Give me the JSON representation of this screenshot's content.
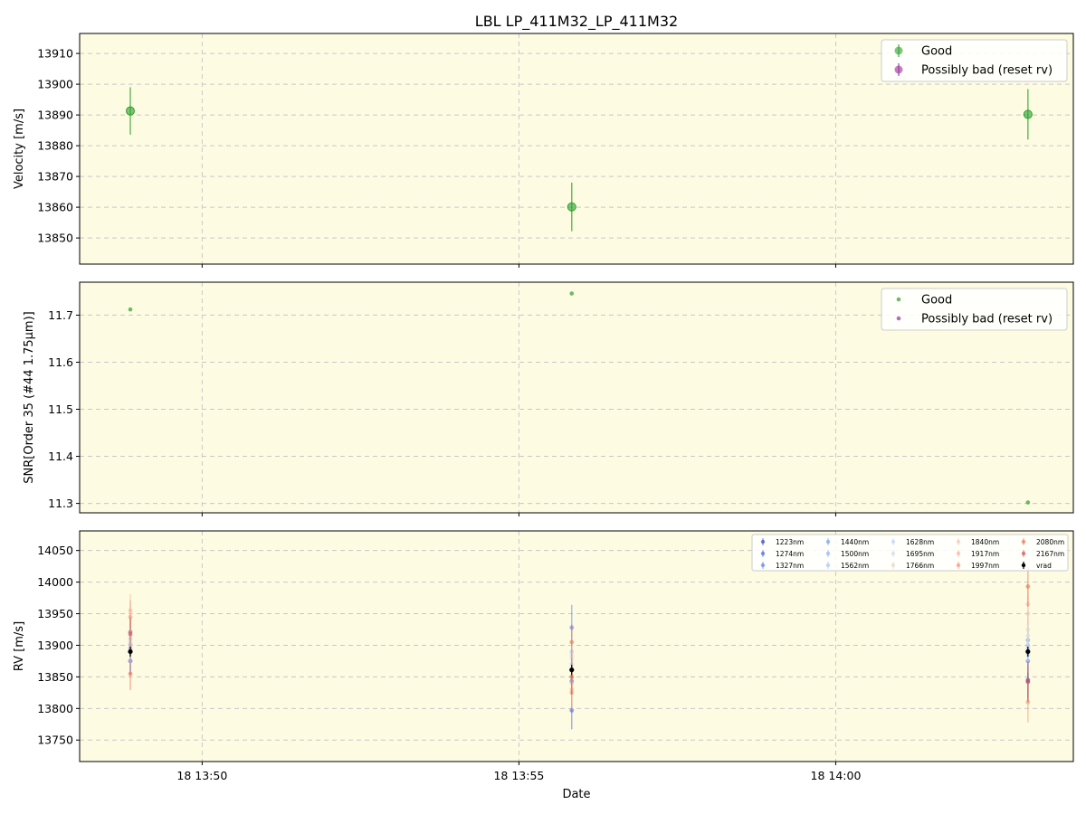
{
  "title": "LBL LP_411M32_LP_411M32",
  "xlabel": "Date",
  "colors": {
    "panel_bg": "#fdfbe2",
    "good": "#2ca02c",
    "bad": "#9b2c9b",
    "vrad": "#000000",
    "grid": "#c8c8c8"
  },
  "x_ticks": [
    {
      "t": "13:50",
      "label": "18 13:50"
    },
    {
      "t": "13:55",
      "label": "18 13:55"
    },
    {
      "t": "14:00",
      "label": "18 14:00"
    }
  ],
  "x_range": [
    "13:48:04",
    "14:03:45"
  ],
  "chart_data": [
    {
      "type": "scatter",
      "name": "velocity",
      "ylabel": "Velocity [m/s]",
      "ylim": [
        13841.5,
        13916.5
      ],
      "yticks": [
        13850,
        13860,
        13870,
        13880,
        13890,
        13900,
        13910
      ],
      "grid": true,
      "legend_position": "top-right",
      "series": [
        {
          "name": "Good",
          "x": [
            "13:48:52",
            "13:55:50",
            "14:03:02"
          ],
          "y": [
            13891.3,
            13860.1,
            13890.2
          ],
          "err": [
            7.7,
            7.9,
            8.2
          ]
        },
        {
          "name": "Possibly bad (reset rv)",
          "x": [],
          "y": [],
          "err": []
        }
      ]
    },
    {
      "type": "scatter",
      "name": "snr",
      "ylabel": "SNR[Order 35 (#44 1.75μm)]",
      "ylim": [
        11.28,
        11.77
      ],
      "yticks": [
        11.3,
        11.4,
        11.5,
        11.6,
        11.7
      ],
      "grid": true,
      "legend_position": "top-right",
      "series": [
        {
          "name": "Good",
          "x": [
            "13:48:52",
            "13:55:50",
            "14:03:02"
          ],
          "y": [
            11.712,
            11.746,
            11.302
          ]
        },
        {
          "name": "Possibly bad (reset rv)",
          "x": [],
          "y": []
        }
      ]
    },
    {
      "type": "scatter",
      "name": "rv",
      "ylabel": "RV [m/s]",
      "ylim": [
        13716,
        14081
      ],
      "yticks": [
        13750,
        13800,
        13850,
        13900,
        13950,
        14000,
        14050
      ],
      "grid": true,
      "legend_position": "top-right",
      "series": [
        {
          "name": "1223nm",
          "color": "#3b4cc0",
          "x": [
            "13:48:52",
            "13:55:50",
            "14:03:02"
          ],
          "y": [
            13875,
            13843,
            13845
          ],
          "err": [
            22,
            28,
            30
          ]
        },
        {
          "name": "1274nm",
          "color": "#4f69d9",
          "x": [
            "13:48:52",
            "13:55:50",
            "14:03:02"
          ],
          "y": [
            13921,
            13797,
            13842
          ],
          "err": [
            22,
            30,
            32
          ]
        },
        {
          "name": "1327nm",
          "color": "#6485ec",
          "x": [
            "13:48:52",
            "13:55:50",
            "14:03:02"
          ],
          "y": [
            13901,
            13928,
            13875
          ],
          "err": [
            22,
            36,
            32
          ]
        },
        {
          "name": "1440nm",
          "color": "#7b9ff9",
          "x": [
            "13:48:52",
            "13:55:50",
            "14:03:02"
          ],
          "y": [
            13895,
            13862,
            13908
          ],
          "err": [
            20,
            26,
            28
          ]
        },
        {
          "name": "1500nm",
          "color": "#93b5fe",
          "x": [
            "13:48:52",
            "13:55:50",
            "14:03:02"
          ],
          "y": [
            13875,
            13843,
            13900
          ],
          "err": [
            20,
            26,
            28
          ]
        },
        {
          "name": "1562nm",
          "color": "#aac7fd",
          "x": [
            "13:48:52",
            "13:55:50",
            "14:03:02"
          ],
          "y": [
            13910,
            13890,
            13895
          ],
          "err": [
            20,
            26,
            28
          ]
        },
        {
          "name": "1628nm",
          "color": "#c0d4f5",
          "x": [
            "13:48:52",
            "13:55:50",
            "14:03:02"
          ],
          "y": [
            13890,
            13870,
            13885
          ],
          "err": [
            20,
            26,
            28
          ]
        },
        {
          "name": "1695nm",
          "color": "#d5dbe5",
          "x": [
            "13:48:52",
            "13:55:50",
            "14:03:02"
          ],
          "y": [
            13905,
            13880,
            13915
          ],
          "err": [
            20,
            26,
            28
          ]
        },
        {
          "name": "1766nm",
          "color": "#e2d9c9",
          "x": [
            "13:48:52",
            "13:55:50",
            "14:03:02"
          ],
          "y": [
            13900,
            13885,
            13925
          ],
          "err": [
            20,
            26,
            28
          ]
        },
        {
          "name": "1840nm",
          "color": "#f2cbb7",
          "x": [
            "13:48:52",
            "13:55:50",
            "14:03:02"
          ],
          "y": [
            13915,
            13840,
            13950
          ],
          "err": [
            22,
            26,
            30
          ]
        },
        {
          "name": "1917nm",
          "color": "#f7b89c",
          "x": [
            "13:48:52",
            "13:55:50",
            "14:03:02"
          ],
          "y": [
            13955,
            13830,
            13965
          ],
          "err": [
            26,
            28,
            32
          ]
        },
        {
          "name": "1997nm",
          "color": "#f4987a",
          "x": [
            "13:48:52",
            "13:55:50",
            "14:03:02"
          ],
          "y": [
            13945,
            13825,
            13810
          ],
          "err": [
            26,
            28,
            32
          ]
        },
        {
          "name": "2080nm",
          "color": "#e8765c",
          "x": [
            "13:48:52",
            "13:55:50",
            "14:03:02"
          ],
          "y": [
            13855,
            13905,
            13993
          ],
          "err": [
            26,
            28,
            32
          ]
        },
        {
          "name": "2167nm",
          "color": "#d65244",
          "x": [
            "13:48:52",
            "13:55:50",
            "14:03:02"
          ],
          "y": [
            13918,
            13850,
            13843
          ],
          "err": [
            26,
            28,
            32
          ]
        },
        {
          "name": "vrad",
          "color": "#000000",
          "x": [
            "13:48:52",
            "13:55:50",
            "14:03:02"
          ],
          "y": [
            13890,
            13861,
            13890
          ],
          "err": [
            8,
            8,
            8
          ]
        }
      ]
    }
  ]
}
